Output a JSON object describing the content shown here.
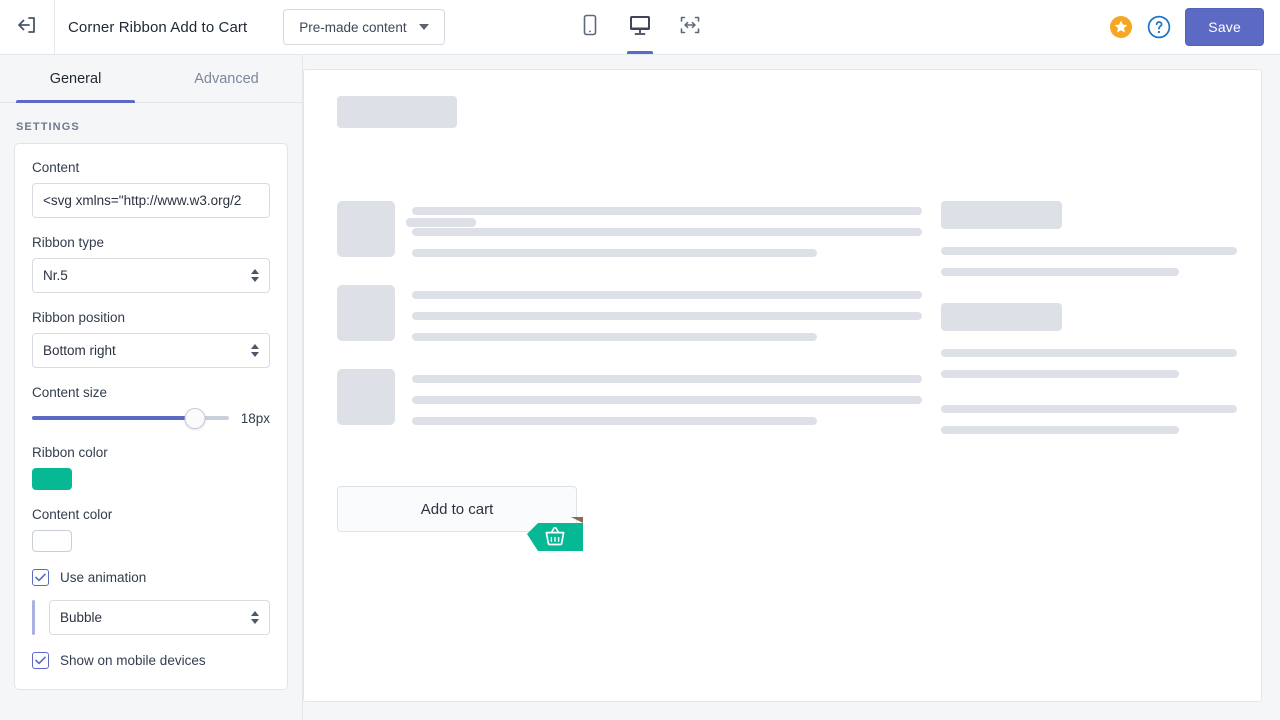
{
  "topbar": {
    "back_icon": "back-arrow-icon",
    "title": "Corner Ribbon Add to Cart",
    "premade_label": "Pre-made content",
    "devices": [
      {
        "name": "mobile",
        "icon": "mobile-icon",
        "active": false
      },
      {
        "name": "desktop",
        "icon": "desktop-icon",
        "active": true
      },
      {
        "name": "fullwidth",
        "icon": "fullwidth-icon",
        "active": false
      }
    ],
    "star_icon": "star-icon",
    "help_icon": "help-circle-icon",
    "save_label": "Save",
    "accent_color": "#5c6ac4"
  },
  "sidebar": {
    "tabs": [
      {
        "label": "General",
        "active": true
      },
      {
        "label": "Advanced",
        "active": false
      }
    ],
    "section_label": "SETTINGS",
    "fields": {
      "content": {
        "label": "Content",
        "value": "<svg xmlns=\"http://www.w3.org/2"
      },
      "ribbon_type": {
        "label": "Ribbon type",
        "value": "Nr.5"
      },
      "ribbon_position": {
        "label": "Ribbon position",
        "value": "Bottom right"
      },
      "content_size": {
        "label": "Content size",
        "value": "18px",
        "percent": 83
      },
      "ribbon_color": {
        "label": "Ribbon color",
        "value": "#06b894"
      },
      "content_color": {
        "label": "Content color",
        "value": "#ffffff"
      },
      "use_animation": {
        "label": "Use animation",
        "checked": true
      },
      "animation_type": {
        "value": "Bubble"
      },
      "show_on_mobile": {
        "label": "Show on mobile devices",
        "checked": true
      }
    }
  },
  "preview": {
    "cart_button_label": "Add to cart",
    "ribbon_icon": "shopping-basket-icon",
    "ribbon_color": "#06b894",
    "ribbon_fold_color": "#8a6a52",
    "skeleton_color": "#dde1e7",
    "media_items": [
      {
        "lines": [
          510,
          510,
          405
        ]
      },
      {
        "lines": [
          510,
          510,
          405
        ]
      },
      {
        "lines": [
          510,
          510,
          405
        ]
      }
    ],
    "right_groups": [
      {
        "block": 121,
        "lines": [
          296,
          238
        ]
      },
      {
        "block": 121,
        "lines": [
          296,
          238
        ]
      },
      {
        "block": 0,
        "lines": [
          296,
          238
        ]
      }
    ],
    "meta_chips": [
      44,
      70
    ]
  }
}
